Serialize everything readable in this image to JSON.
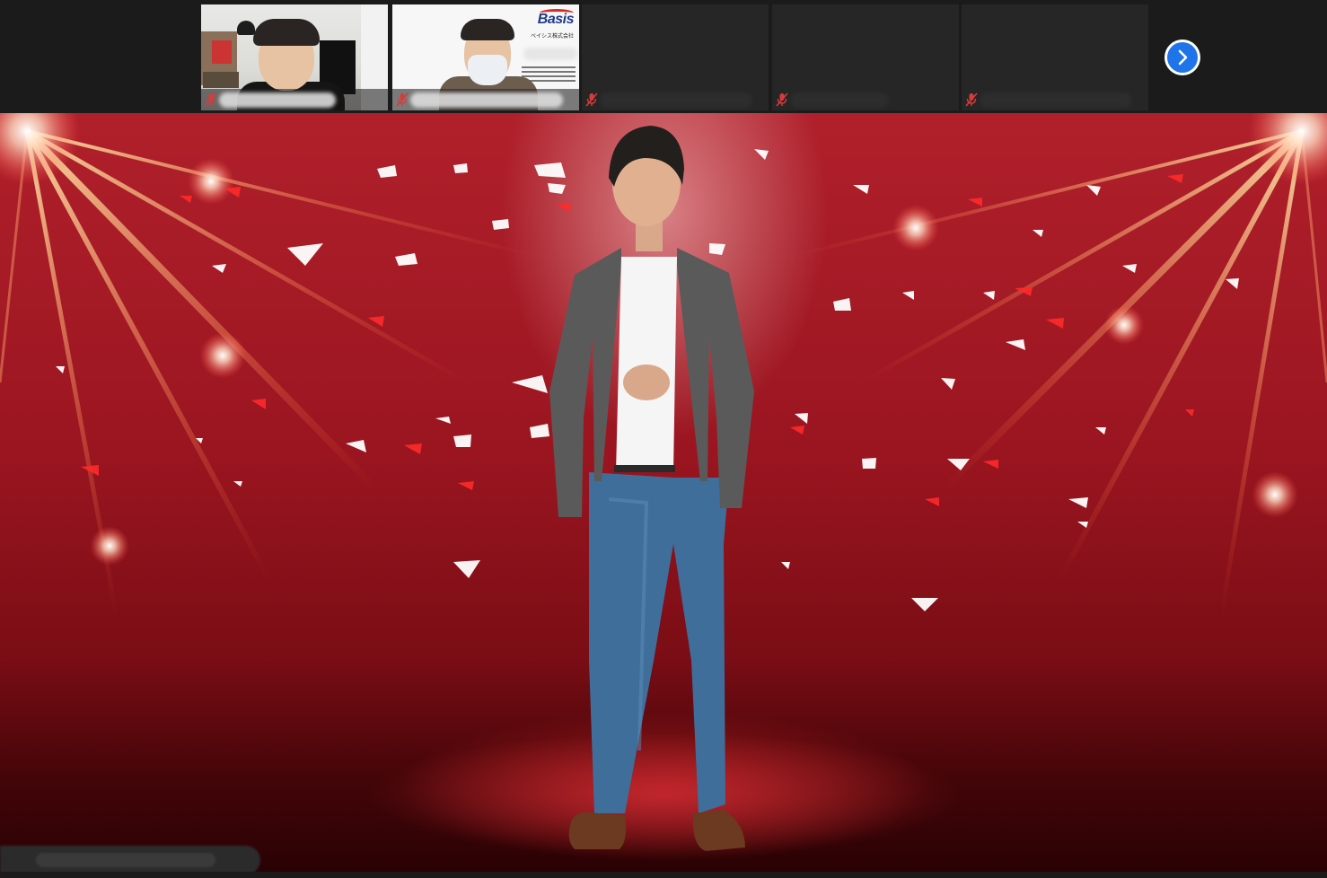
{
  "window": {
    "app": "video-meeting",
    "layout": "speaker-view"
  },
  "participants": [
    {
      "id": "p1",
      "video": "on",
      "name": "",
      "muted": true
    },
    {
      "id": "p2",
      "video": "on",
      "name": "",
      "muted": true,
      "background_text": {
        "logo": "Basis",
        "company": "ベイシス株式会社"
      }
    },
    {
      "id": "p3",
      "video": "off",
      "name": "",
      "muted": true
    },
    {
      "id": "p4",
      "video": "off",
      "name": "",
      "muted": true
    },
    {
      "id": "p5",
      "video": "off",
      "name": "",
      "muted": true
    }
  ],
  "controls": {
    "next_page_icon": "chevron-right-icon"
  },
  "active_speaker": {
    "name": "",
    "virtual_background": "red-stage-confetti"
  },
  "colors": {
    "accent": "#1e74e8",
    "mute": "#d93b3b",
    "stage_red": "#a8192a",
    "toolbar": "#1b1b1b"
  }
}
